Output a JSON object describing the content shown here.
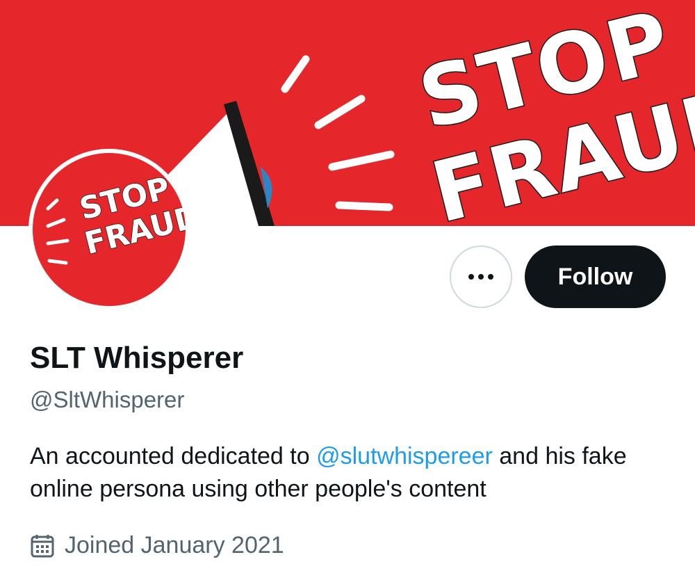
{
  "banner": {
    "image_text_line1": "STOP",
    "image_text_line2": "FRAUD"
  },
  "avatar": {
    "image_text_line1": "STOP",
    "image_text_line2": "FRAUD"
  },
  "actions": {
    "more_icon": "ellipsis-icon",
    "follow_label": "Follow"
  },
  "profile": {
    "display_name": "SLT Whisperer",
    "handle": "@SltWhisperer",
    "bio_prefix": "An accounted dedicated to ",
    "bio_mention": "@slutwhispereer",
    "bio_suffix": " and his fake online persona using other people's content",
    "joined_icon": "calendar-icon",
    "joined_text": "Joined January 2021"
  },
  "colors": {
    "banner_red": "#e5262a",
    "follow_bg": "#0f1419",
    "mention_blue": "#1d9bf0",
    "secondary_text": "#536471"
  }
}
